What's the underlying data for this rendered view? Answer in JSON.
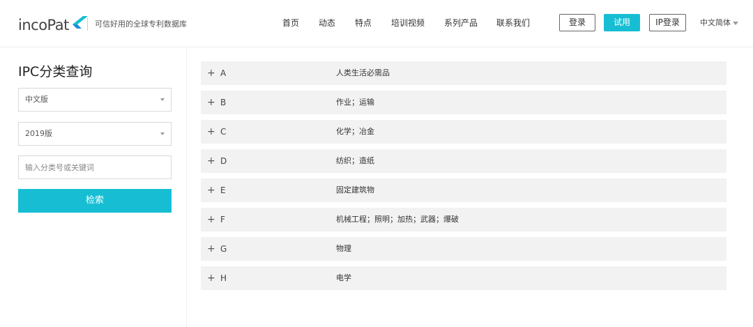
{
  "header": {
    "logo": {
      "text_inco": "inco",
      "text_pat": "Pat"
    },
    "slogan": "可信好用的全球专利数据库",
    "nav": [
      "首页",
      "动态",
      "特点",
      "培训视频",
      "系列产品",
      "联系我们"
    ],
    "login_label": "登录",
    "trial_label": "试用",
    "ip_login_label": "IP登录",
    "language": "中文简体"
  },
  "sidebar": {
    "title": "IPC分类查询",
    "language_select": "中文版",
    "version_select": "2019版",
    "search_placeholder": "输入分类号或关键词",
    "search_button": "检索"
  },
  "ipc_sections": [
    {
      "plus": "+",
      "code": "A",
      "desc": "人类生活必需品"
    },
    {
      "plus": "+",
      "code": "B",
      "desc": "作业；运输"
    },
    {
      "plus": "+",
      "code": "C",
      "desc": "化学；冶金"
    },
    {
      "plus": "+",
      "code": "D",
      "desc": "纺织；造纸"
    },
    {
      "plus": "+",
      "code": "E",
      "desc": "固定建筑物"
    },
    {
      "plus": "+",
      "code": "F",
      "desc": "机械工程；照明；加热；武器；爆破"
    },
    {
      "plus": "+",
      "code": "G",
      "desc": "物理"
    },
    {
      "plus": "+",
      "code": "H",
      "desc": "电学"
    }
  ],
  "colors": {
    "accent": "#17bed3",
    "row_bg": "#f2f2f2",
    "border": "#d9d9d9"
  },
  "icons": {
    "logo_mark": "incopat-logo-mark-icon",
    "dropdown": "caret-down-icon",
    "expand": "plus-icon"
  }
}
